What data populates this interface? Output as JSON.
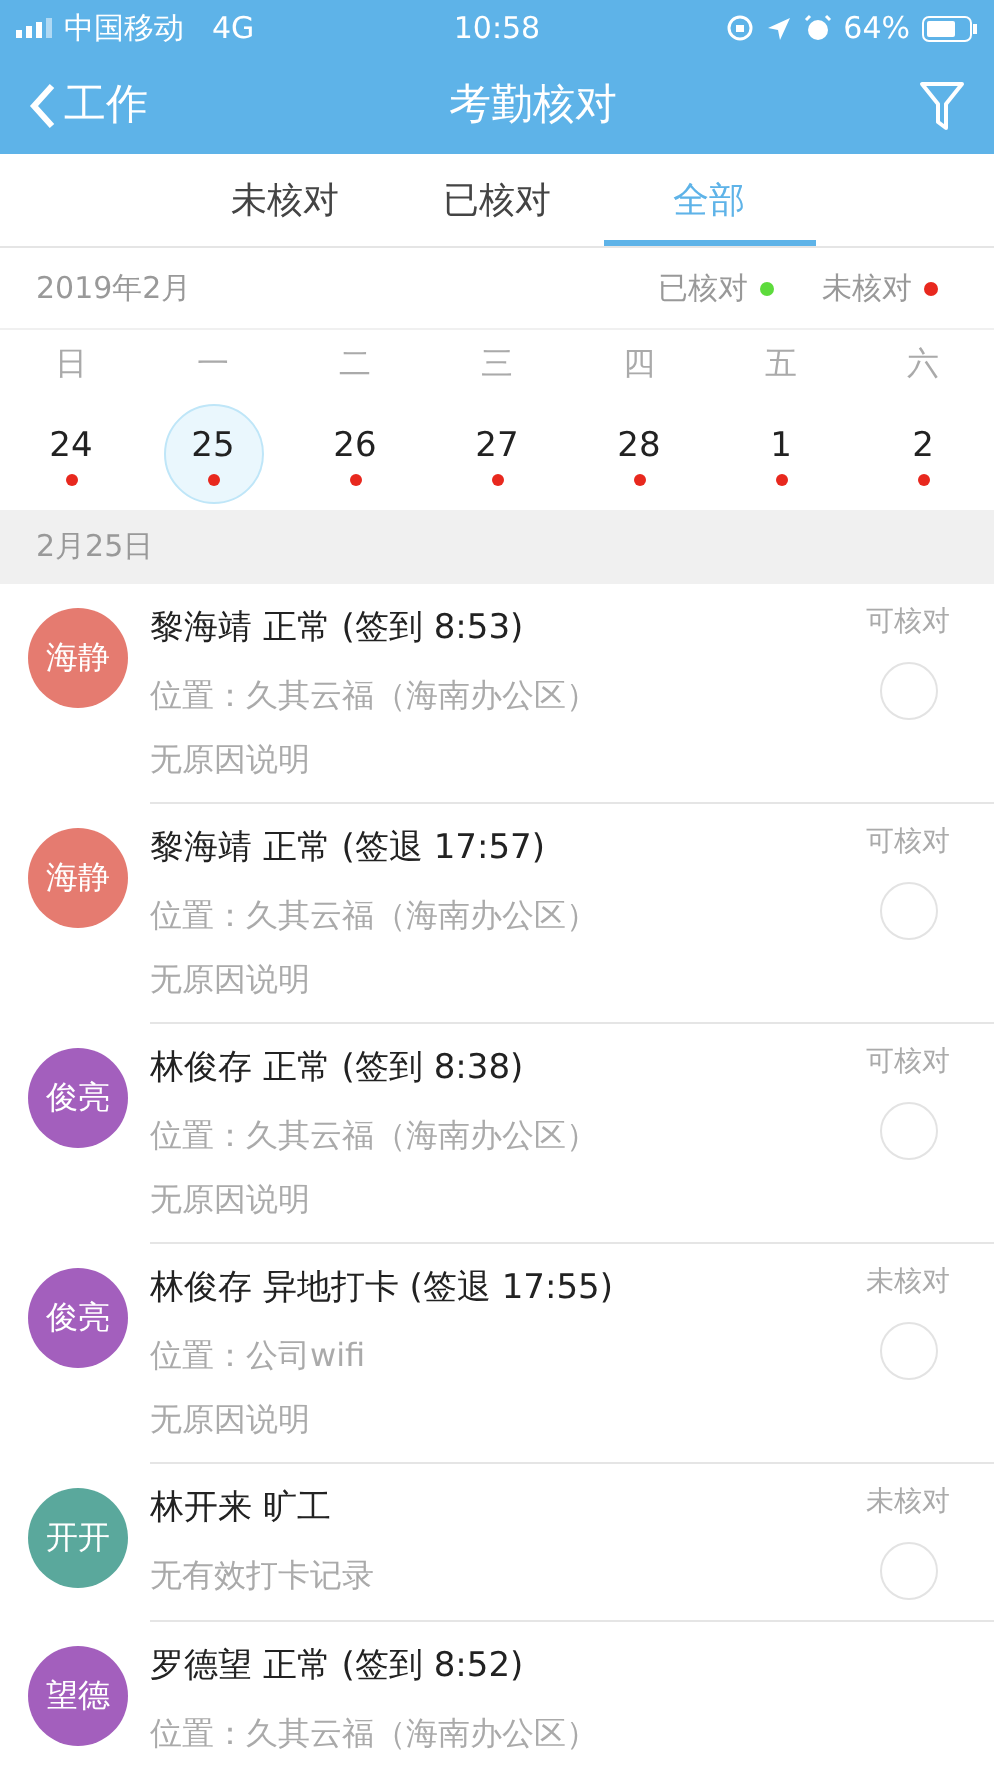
{
  "status_bar": {
    "carrier": "中国移动",
    "network": "4G",
    "time": "10:58",
    "battery_text": "64%"
  },
  "header": {
    "back_label": "工作",
    "title": "考勤核对"
  },
  "tabs": [
    {
      "label": "未核对",
      "selected": false
    },
    {
      "label": "已核对",
      "selected": false
    },
    {
      "label": "全部",
      "selected": true
    }
  ],
  "calendar": {
    "month": "2019年2月",
    "legend": [
      {
        "label": "已核对",
        "color": "#5ddb3c"
      },
      {
        "label": "未核对",
        "color": "#e8281e"
      }
    ],
    "weekdays": [
      "日",
      "一",
      "二",
      "三",
      "四",
      "五",
      "六"
    ],
    "days": [
      {
        "date": "24",
        "selected": false,
        "color": "#e8281e"
      },
      {
        "date": "25",
        "selected": true,
        "color": "#e8281e"
      },
      {
        "date": "26",
        "selected": false,
        "color": "#e8281e"
      },
      {
        "date": "27",
        "selected": false,
        "color": "#e8281e"
      },
      {
        "date": "28",
        "selected": false,
        "color": "#e8281e"
      },
      {
        "date": "1",
        "selected": false,
        "color": "#e8281e"
      },
      {
        "date": "2",
        "selected": false,
        "color": "#e8281e"
      }
    ]
  },
  "section_header": "2月25日",
  "records": [
    {
      "avatar": "海静",
      "color": "#e57b70",
      "title": "黎海靖 正常 (签到 8:53)",
      "lines": [
        "位置：久其云福（海南办公区）",
        "无原因说明"
      ],
      "status": "可核对",
      "checked": false
    },
    {
      "avatar": "海静",
      "color": "#e57b70",
      "title": "黎海靖 正常 (签退 17:57)",
      "lines": [
        "位置：久其云福（海南办公区）",
        "无原因说明"
      ],
      "status": "可核对",
      "checked": false
    },
    {
      "avatar": "俊亮",
      "color": "#a35fbd",
      "title": "林俊存 正常 (签到 8:38)",
      "lines": [
        "位置：久其云福（海南办公区）",
        "无原因说明"
      ],
      "status": "可核对",
      "checked": false
    },
    {
      "avatar": "俊亮",
      "color": "#a35fbd",
      "title": "林俊存 异地打卡 (签退 17:55)",
      "lines": [
        "位置：公司wifi",
        "无原因说明"
      ],
      "status": "未核对",
      "checked": false
    },
    {
      "avatar": "开开",
      "color": "#5aa89c",
      "title": "林开来 旷工",
      "lines": [
        "无有效打卡记录"
      ],
      "status": "未核对",
      "checked": false
    },
    {
      "avatar": "望德",
      "color": "#a35fbd",
      "title": "罗德望 正常 (签到 8:52)",
      "lines": [
        "位置：久其云福（海南办公区）"
      ]
    }
  ]
}
